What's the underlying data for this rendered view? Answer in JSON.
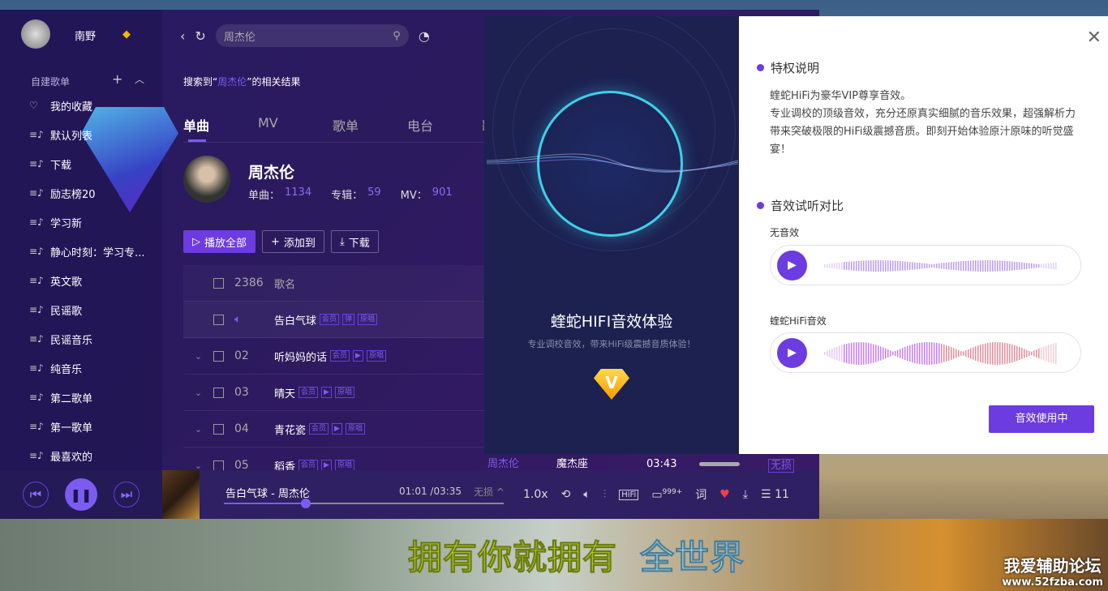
{
  "user": {
    "name": "南野"
  },
  "sidebar": {
    "section": "自建歌单",
    "items": [
      {
        "icon": "heart-icon",
        "label": "我的收藏"
      },
      {
        "icon": "playlist-icon",
        "label": "默认列表"
      },
      {
        "icon": "playlist-icon",
        "label": "下载"
      },
      {
        "icon": "playlist-icon",
        "label": "励志榜20"
      },
      {
        "icon": "playlist-icon",
        "label": "学习新"
      },
      {
        "icon": "playlist-icon",
        "label": "静心时刻：学习专..."
      },
      {
        "icon": "playlist-icon",
        "label": "英文歌"
      },
      {
        "icon": "playlist-icon",
        "label": "民谣歌"
      },
      {
        "icon": "playlist-icon",
        "label": "民谣音乐"
      },
      {
        "icon": "playlist-icon",
        "label": "纯音乐"
      },
      {
        "icon": "playlist-icon",
        "label": "第二歌单"
      },
      {
        "icon": "playlist-icon",
        "label": "第一歌单"
      },
      {
        "icon": "playlist-icon",
        "label": "最喜欢的"
      }
    ]
  },
  "search": {
    "value": "周杰伦",
    "result_prefix": "搜索到“",
    "result_keyword": "周杰伦",
    "result_suffix": "”的相关结果"
  },
  "tabs": [
    "单曲",
    "MV",
    "歌单",
    "电台",
    "歌"
  ],
  "artist": {
    "name": "周杰伦",
    "songs_label": "单曲：",
    "songs": "1134",
    "albums_label": "专辑：",
    "albums": "59",
    "mv_label": "MV：",
    "mv": "901"
  },
  "actions": {
    "play_all": "播放全部",
    "add_to": "添加到",
    "download": "下载"
  },
  "list": {
    "count": "2386",
    "col_name": "歌名",
    "rows": [
      {
        "num": "",
        "title": "告白气球",
        "tags": [
          "会员",
          "弹",
          "原唱"
        ]
      },
      {
        "num": "02",
        "title": "听妈妈的话",
        "tags": [
          "会员",
          "▶",
          "原唱"
        ]
      },
      {
        "num": "03",
        "title": "晴天",
        "tags": [
          "会员",
          "▶",
          "原唱"
        ]
      },
      {
        "num": "04",
        "title": "青花瓷",
        "tags": [
          "会员",
          "▶",
          "原唱"
        ]
      },
      {
        "num": "05",
        "title": "稻香",
        "tags": [
          "会员",
          "▶",
          "原唱"
        ],
        "artist": "周杰伦",
        "album": "魔杰座",
        "duration": "03:43",
        "quality": "无损"
      }
    ]
  },
  "player": {
    "title": "告白气球 - 周杰伦",
    "time": "01:01 /03:35",
    "quality": "无损",
    "progress": 0.293,
    "speed": "1.0x",
    "hifi": "HiFi",
    "comments": "999+",
    "lyric": "词",
    "queue": "11"
  },
  "dialog": {
    "title": "蝰蛇HIFI音效体验",
    "subtitle": "专业调校音效，带来HiFi级震撼音质体验！",
    "sec1": "特权说明",
    "para1": "蝰蛇HiFi为豪华VIP尊享音效。",
    "para2": "专业调校的顶级音效，充分还原真实细腻的音乐效果，超强解析力带来突破极限的HiFi级震撼音质。即刻开始体验原汁原味的听觉盛宴！",
    "sec2": "音效试听对比",
    "label_a": "无音效",
    "label_b": "蝰蛇HiFi音效",
    "use_button": "音效使用中"
  },
  "lyrics": {
    "part1": "拥有你就拥有",
    "part2": "全世界"
  },
  "watermark": {
    "title": "我爱辅助论坛",
    "url": "www.52fzba.com"
  },
  "colors": {
    "accent": "#6c3ce0"
  }
}
